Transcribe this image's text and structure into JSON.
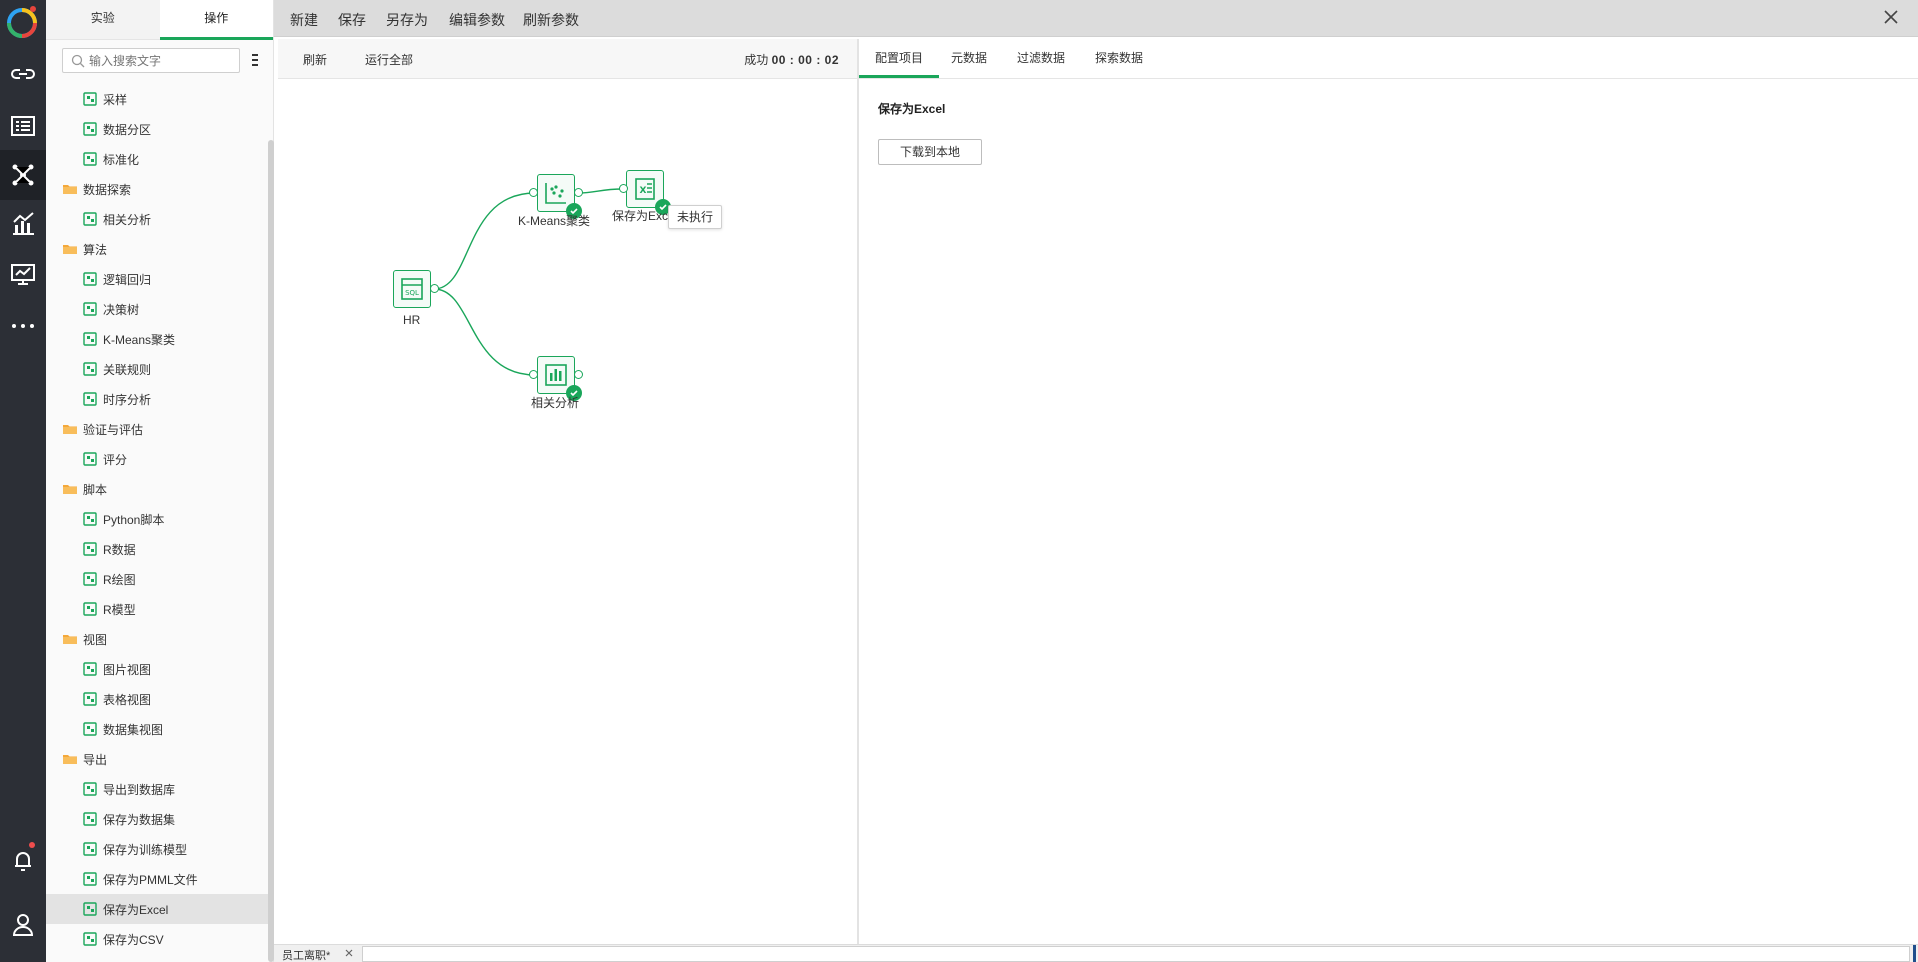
{
  "side": {
    "tabs": [
      "实验",
      "操作"
    ],
    "search_placeholder": "输入搜索文字",
    "tree": [
      {
        "type": "leaf",
        "label": "采样",
        "icon": "sample-icon"
      },
      {
        "type": "leaf",
        "label": "数据分区",
        "icon": "partition-icon"
      },
      {
        "type": "leaf",
        "label": "标准化",
        "icon": "normalize-icon"
      },
      {
        "type": "folder",
        "label": "数据探索"
      },
      {
        "type": "leaf",
        "label": "相关分析",
        "icon": "correlation-icon"
      },
      {
        "type": "folder",
        "label": "算法"
      },
      {
        "type": "leaf",
        "label": "逻辑回归",
        "icon": "regression-icon"
      },
      {
        "type": "leaf",
        "label": "决策树",
        "icon": "tree-icon"
      },
      {
        "type": "leaf",
        "label": "K-Means聚类",
        "icon": "cluster-icon"
      },
      {
        "type": "leaf",
        "label": "关联规则",
        "icon": "association-icon"
      },
      {
        "type": "leaf",
        "label": "时序分析",
        "icon": "timeseries-icon"
      },
      {
        "type": "folder",
        "label": "验证与评估"
      },
      {
        "type": "leaf",
        "label": "评分",
        "icon": "score-icon"
      },
      {
        "type": "folder",
        "label": "脚本"
      },
      {
        "type": "leaf",
        "label": "Python脚本",
        "icon": "python-icon"
      },
      {
        "type": "leaf",
        "label": "R数据",
        "icon": "r-data-icon"
      },
      {
        "type": "leaf",
        "label": "R绘图",
        "icon": "r-plot-icon"
      },
      {
        "type": "leaf",
        "label": "R模型",
        "icon": "r-model-icon"
      },
      {
        "type": "folder",
        "label": "视图"
      },
      {
        "type": "leaf",
        "label": "图片视图",
        "icon": "image-view-icon"
      },
      {
        "type": "leaf",
        "label": "表格视图",
        "icon": "table-view-icon"
      },
      {
        "type": "leaf",
        "label": "数据集视图",
        "icon": "dataset-view-icon"
      },
      {
        "type": "folder",
        "label": "导出"
      },
      {
        "type": "leaf",
        "label": "导出到数据库",
        "icon": "export-db-icon"
      },
      {
        "type": "leaf",
        "label": "保存为数据集",
        "icon": "save-dataset-icon"
      },
      {
        "type": "leaf",
        "label": "保存为训练模型",
        "icon": "save-model-icon"
      },
      {
        "type": "leaf",
        "label": "保存为PMML文件",
        "icon": "save-pmml-icon"
      },
      {
        "type": "leaf",
        "label": "保存为Excel",
        "icon": "save-excel-icon",
        "selected": true
      },
      {
        "type": "leaf",
        "label": "保存为CSV",
        "icon": "save-csv-icon"
      }
    ]
  },
  "topbar": {
    "items": [
      "新建",
      "保存",
      "另存为",
      "编辑参数",
      "刷新参数"
    ]
  },
  "toolbar": {
    "refresh": "刷新",
    "run_all": "运行全部",
    "status_label": "成功",
    "status_time": "00 : 00 : 02"
  },
  "canvas": {
    "nodes": {
      "hr": "HR",
      "kmeans": "K-Means聚类",
      "excel": "保存为Excel",
      "corr": "相关分析"
    },
    "tooltip": "未执行"
  },
  "right_panel": {
    "tabs": [
      "配置项目",
      "元数据",
      "过滤数据",
      "探索数据"
    ],
    "title": "保存为Excel",
    "download_button": "下载到本地"
  },
  "bottom": {
    "tab_label": "员工离职*"
  },
  "colors": {
    "accent": "#1aa65a",
    "rail": "#2c2f36",
    "topbar": "#dcdcdc"
  }
}
